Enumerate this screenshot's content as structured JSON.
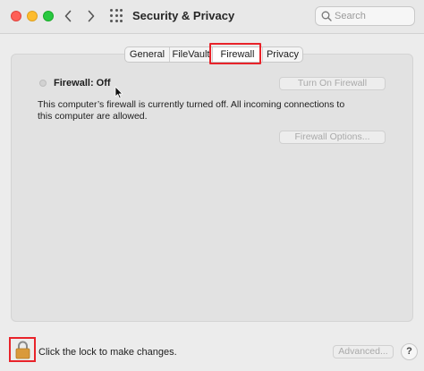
{
  "window": {
    "title": "Security & Privacy"
  },
  "search": {
    "placeholder": "Search"
  },
  "tabs": [
    {
      "label": "General"
    },
    {
      "label": "FileVault"
    },
    {
      "label": "Firewall"
    },
    {
      "label": "Privacy"
    }
  ],
  "firewall": {
    "status_label": "Firewall: Off",
    "turn_on_label": "Turn On Firewall",
    "description": "This computer’s firewall is currently turned off. All incoming connections to this computer are allowed.",
    "options_label": "Firewall Options..."
  },
  "footer": {
    "lock_text": "Click the lock to make changes.",
    "advanced_label": "Advanced...",
    "help_label": "?"
  },
  "colors": {
    "highlight": "#e8232a",
    "lock": "#d99a3b"
  }
}
